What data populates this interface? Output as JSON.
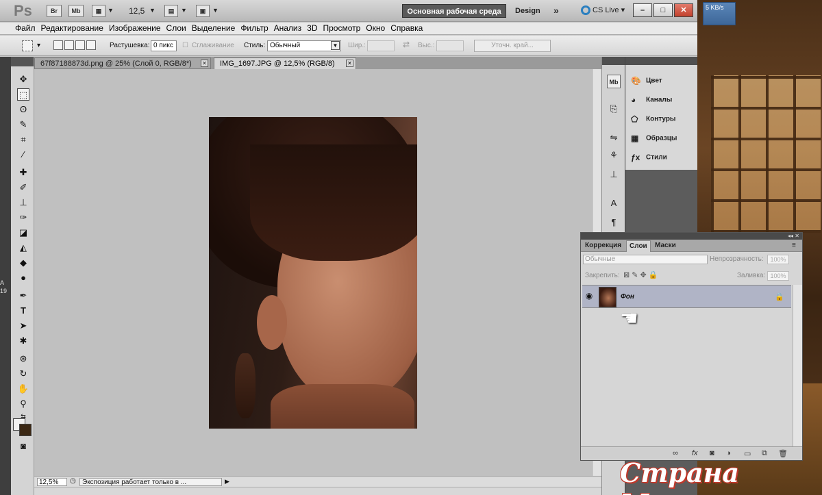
{
  "appbar": {
    "logo": "Ps",
    "bridge": "Br",
    "minibridge": "Mb",
    "zoom": "12,5",
    "workspace_active": "Основная рабочая среда",
    "workspace_design": "Design",
    "workspace_more": "»",
    "cs_live": "CS Live",
    "win_min": "–",
    "win_max": "□",
    "win_close": "✕"
  },
  "netmon": {
    "speed": "5 KB/s"
  },
  "menu": [
    "Файл",
    "Редактирование",
    "Изображение",
    "Слои",
    "Выделение",
    "Фильтр",
    "Анализ",
    "3D",
    "Просмотр",
    "Окно",
    "Справка"
  ],
  "options": {
    "feather_label": "Растушевка:",
    "feather_value": "0 пикс",
    "antialias_label": "Сглаживание",
    "style_label": "Стиль:",
    "style_value": "Обычный",
    "width_label": "Шир.:",
    "height_label": "Выс.:",
    "refine_edge": "Уточн. край..."
  },
  "tabs": [
    {
      "label": "67f87188873d.png @ 25% (Слой 0, RGB/8*)",
      "close": "✕"
    },
    {
      "label": "IMG_1697.JPG @ 12,5% (RGB/8)",
      "close": "✕"
    }
  ],
  "status": {
    "zoom": "12,5%",
    "message": "Экспозиция работает только в ...",
    "arrow": "▶"
  },
  "dock_panels": [
    {
      "label": "Цвет",
      "icon": "palette-icon"
    },
    {
      "label": "Каналы",
      "icon": "channels-icon"
    },
    {
      "label": "Контуры",
      "icon": "paths-icon"
    },
    {
      "label": "Образцы",
      "icon": "swatches-icon"
    },
    {
      "label": "Стили",
      "icon": "styles-icon"
    }
  ],
  "layers_panel": {
    "tabs": [
      "Коррекция",
      "Слои",
      "Маски"
    ],
    "blend_mode": "Обычные",
    "opacity_label": "Непрозрачность:",
    "opacity_value": "100%",
    "lock_label": "Закрепить:",
    "fill_label": "Заливка:",
    "fill_value": "100%",
    "layer_name": "Фон"
  },
  "watermark": "Страна Мам.ру",
  "left_edge": {
    "a": "A",
    "b": "19"
  }
}
